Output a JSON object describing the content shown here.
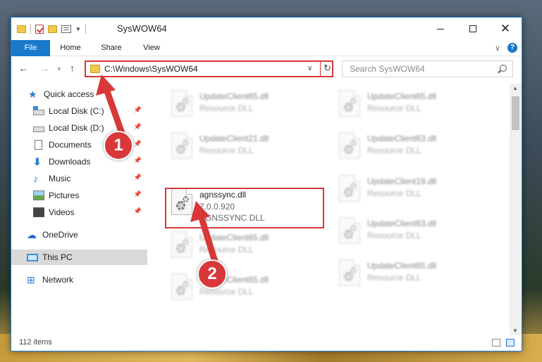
{
  "window": {
    "title": "SysWOW64",
    "controls": {
      "minimize": "minimize-icon",
      "maximize": "maximize-icon",
      "close": "✕"
    }
  },
  "ribbon": {
    "tabs": [
      "File",
      "Home",
      "Share",
      "View"
    ],
    "help": "?"
  },
  "nav": {
    "back": "←",
    "forward": "→",
    "recent": "∨",
    "up": "↑",
    "address": "C:\\Windows\\SysWOW64",
    "address_dropdown": "∨",
    "refresh": "↻",
    "search_placeholder": "Search SysWOW64"
  },
  "sidebar": {
    "items": [
      {
        "label": "Quick access",
        "icon": "star-icon",
        "pinned": false
      },
      {
        "label": "Local Disk (C:)",
        "icon": "drive-icon",
        "pinned": true
      },
      {
        "label": "Local Disk (D:)",
        "icon": "drive-icon",
        "pinned": true
      },
      {
        "label": "Documents",
        "icon": "documents-icon",
        "pinned": true
      },
      {
        "label": "Downloads",
        "icon": "download-icon",
        "pinned": true
      },
      {
        "label": "Music",
        "icon": "music-icon",
        "pinned": true
      },
      {
        "label": "Pictures",
        "icon": "pictures-icon",
        "pinned": true
      },
      {
        "label": "Videos",
        "icon": "videos-icon",
        "pinned": true
      },
      {
        "label": "OneDrive",
        "icon": "onedrive-icon",
        "pinned": false
      },
      {
        "label": "This PC",
        "icon": "computer-icon",
        "pinned": false,
        "selected": true
      },
      {
        "label": "Network",
        "icon": "network-icon",
        "pinned": false
      }
    ],
    "pin_glyph": "📌"
  },
  "files": {
    "left": [
      {
        "name": "UpdateClient65.dll",
        "line2": "Resource DLL",
        "line3": ""
      },
      {
        "name": "UpdateClient21.dll",
        "line2": "Resource DLL",
        "line3": ""
      },
      {
        "name": "agnssync.dll",
        "line2": "7.0.0.920",
        "line3": "AGNSSYNC DLL"
      },
      {
        "name": "UpdateClient65.dll",
        "line2": "Resource DLL",
        "line3": ""
      },
      {
        "name": "UpdateClient65.dll",
        "line2": "Resource DLL",
        "line3": ""
      }
    ],
    "right": [
      {
        "name": "UpdateClient65.dll",
        "line2": "Resource DLL"
      },
      {
        "name": "UpdateClient63.dll",
        "line2": "Resource DLL"
      },
      {
        "name": "UpdateClient19.dll",
        "line2": "Resource DLL"
      },
      {
        "name": "UpdateClient63.dll",
        "line2": "Resource DLL"
      },
      {
        "name": "UpdateClient65.dll",
        "line2": "Resource DLL"
      }
    ]
  },
  "status": {
    "item_count": "112 items"
  },
  "annotations": {
    "step1": "1",
    "step2": "2",
    "color": "#d9383a"
  }
}
